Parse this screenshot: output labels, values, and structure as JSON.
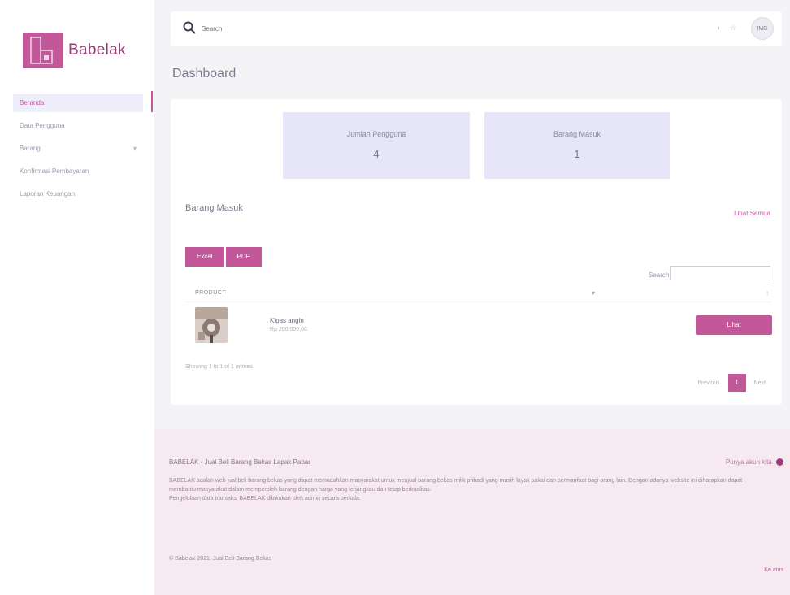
{
  "brand": {
    "name": "Babelak",
    "accent": "#c2579a",
    "dark_accent": "#9a3d78"
  },
  "sidebar": {
    "items": [
      {
        "label": "Beranda",
        "active": true
      },
      {
        "label": "Data Pengguna",
        "active": false
      },
      {
        "label": "Barang",
        "active": false,
        "has_caret": true,
        "caret": "▾"
      },
      {
        "label": "Konfirmasi Pembayaran",
        "active": false
      },
      {
        "label": "Laporan Keuangan",
        "active": false
      }
    ]
  },
  "topbar": {
    "search_placeholder": "Search",
    "icons_text": "◐ ☆",
    "avatar_text": "IMG"
  },
  "page_title": "Dashboard",
  "stats": [
    {
      "label": "Jumlah Pengguna",
      "value": "4"
    },
    {
      "label": "Barang Masuk",
      "value": "1"
    }
  ],
  "section": {
    "title": "Barang Masuk",
    "see_all": "Lihat Semua"
  },
  "buttons": {
    "excel": "Excel",
    "pdf": "PDF"
  },
  "table": {
    "search_label": "Search:",
    "header_product": "PRODUCT",
    "sort_indicator": "▾",
    "sort_indicator_2": "↕",
    "rows": [
      {
        "name": "Kipas angin",
        "price": "Rp 200.000,00",
        "action": "Lihat"
      }
    ],
    "info": "Showing 1 to 1 of 1 entries",
    "pager": {
      "prev": "Previous",
      "page": "1",
      "next": "Next"
    }
  },
  "footer": {
    "title": "BABELAK - Jual Beli Barang Bekas Lapak Pabar",
    "right_text": "Punya akun kita",
    "description": "BABELAK adalah web jual beli barang bekas yang dapat memudahkan masyarakat untuk menjual barang bekas milik pribadi yang masih layak pakai dan bermanfaat bagi orang lain. Dengan adanya website ini diharapkan dapat membantu masyarakat dalam memperoleh barang dengan harga yang terjangkau dan tetap berkualitas.",
    "description_2": "Pengelolaan data transaksi BABELAK dilakukan oleh admin secara berkala.",
    "copyright": "© Babelak 2021. Jual Beli Barang Bekas",
    "link": "Ke atas"
  }
}
